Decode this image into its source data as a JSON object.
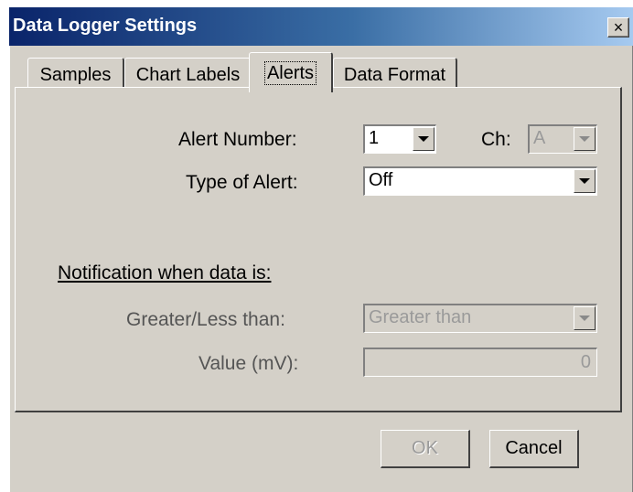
{
  "window": {
    "title": "Data Logger Settings",
    "close_glyph": "×"
  },
  "tabs": [
    {
      "label": "Samples",
      "active": false
    },
    {
      "label": "Chart Labels",
      "active": false
    },
    {
      "label": "Alerts",
      "active": true
    },
    {
      "label": "Data Format",
      "active": false
    }
  ],
  "alerts": {
    "alert_number_label": "Alert Number:",
    "alert_number_value": "1",
    "channel_label": "Ch:",
    "channel_value": "A",
    "type_label": "Type of Alert:",
    "type_value": "Off",
    "notification_label": "Notification when data is:",
    "comparison_label": "Greater/Less than:",
    "comparison_value": "Greater than",
    "value_label": "Value (mV):",
    "value_value": "0"
  },
  "buttons": {
    "ok_label": "OK",
    "cancel_label": "Cancel"
  },
  "colors": {
    "dialog_face": "#d4d0c8",
    "titlebar_start": "#0a246a",
    "titlebar_end": "#a6caf0",
    "disabled_text": "#9a9a9a"
  }
}
